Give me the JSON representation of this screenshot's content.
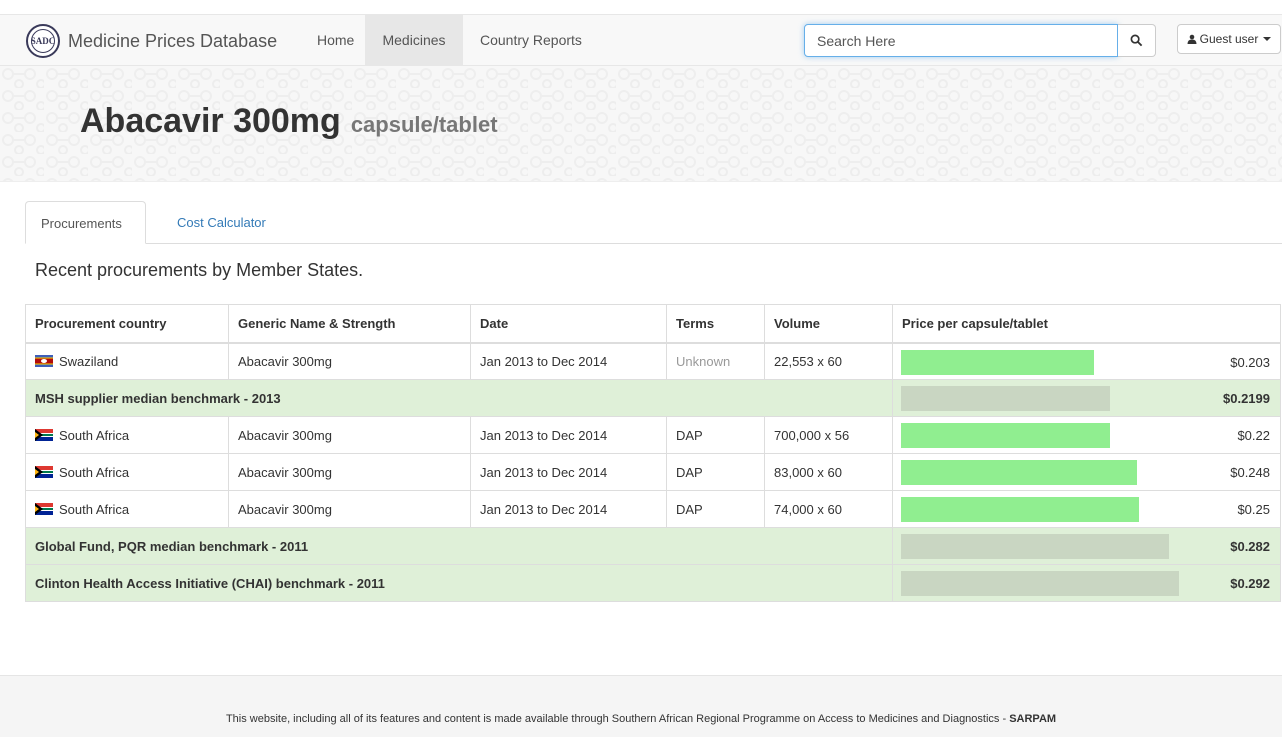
{
  "nav": {
    "brand_logo_text": "SADC",
    "brand_name": "Medicine Prices Database",
    "links": [
      "Home",
      "Medicines",
      "Country Reports"
    ],
    "search_placeholder": "Search Here",
    "user_label": "Guest user",
    "icons": {
      "search": "search-icon",
      "user": "user-icon",
      "dropdown": "caret-down-icon"
    }
  },
  "hero": {
    "medicine": "Abacavir 300mg",
    "form": "capsule/tablet"
  },
  "tabs": [
    "Procurements",
    "Cost Calculator"
  ],
  "section_title": "Recent procurements by Member States.",
  "table": {
    "headers": [
      "Procurement country",
      "Generic Name & Strength",
      "Date",
      "Terms",
      "Volume",
      "Price per capsule/tablet"
    ],
    "rows": [
      {
        "type": "procurement",
        "country": "Swaziland",
        "flag": "swaziland-flag",
        "generic": "Abacavir 300mg",
        "date": "Jan 2013 to Dec 2014",
        "terms": "Unknown",
        "volume": "22,553 x 60",
        "price": "$0.203",
        "price_value": 0.203
      },
      {
        "type": "benchmark",
        "label": "MSH supplier median benchmark - 2013",
        "price": "$0.2199",
        "price_value": 0.2199
      },
      {
        "type": "procurement",
        "country": "South Africa",
        "flag": "south-africa-flag",
        "generic": "Abacavir 300mg",
        "date": "Jan 2013 to Dec 2014",
        "terms": "DAP",
        "volume": "700,000 x 56",
        "price": "$0.22",
        "price_value": 0.22
      },
      {
        "type": "procurement",
        "country": "South Africa",
        "flag": "south-africa-flag",
        "generic": "Abacavir 300mg",
        "date": "Jan 2013 to Dec 2014",
        "terms": "DAP",
        "volume": "83,000 x 60",
        "price": "$0.248",
        "price_value": 0.248
      },
      {
        "type": "procurement",
        "country": "South Africa",
        "flag": "south-africa-flag",
        "generic": "Abacavir 300mg",
        "date": "Jan 2013 to Dec 2014",
        "terms": "DAP",
        "volume": "74,000 x 60",
        "price": "$0.25",
        "price_value": 0.25
      },
      {
        "type": "benchmark",
        "label": "Global Fund, PQR median benchmark - 2011",
        "price": "$0.282",
        "price_value": 0.282
      },
      {
        "type": "benchmark",
        "label": "Clinton Health Access Initiative (CHAI) benchmark - 2011",
        "price": "$0.292",
        "price_value": 0.292
      }
    ]
  },
  "colors": {
    "procurement_bar": "#90ee90",
    "benchmark_bar": "#c9d6c2",
    "benchmark_row": "#dff0d8",
    "link": "#337ab7"
  },
  "footer": {
    "text": "This website, including all of its features and content is made available through Southern African Regional Programme on Access to Medicines and Diagnostics - ",
    "bold": "SARPAM"
  }
}
